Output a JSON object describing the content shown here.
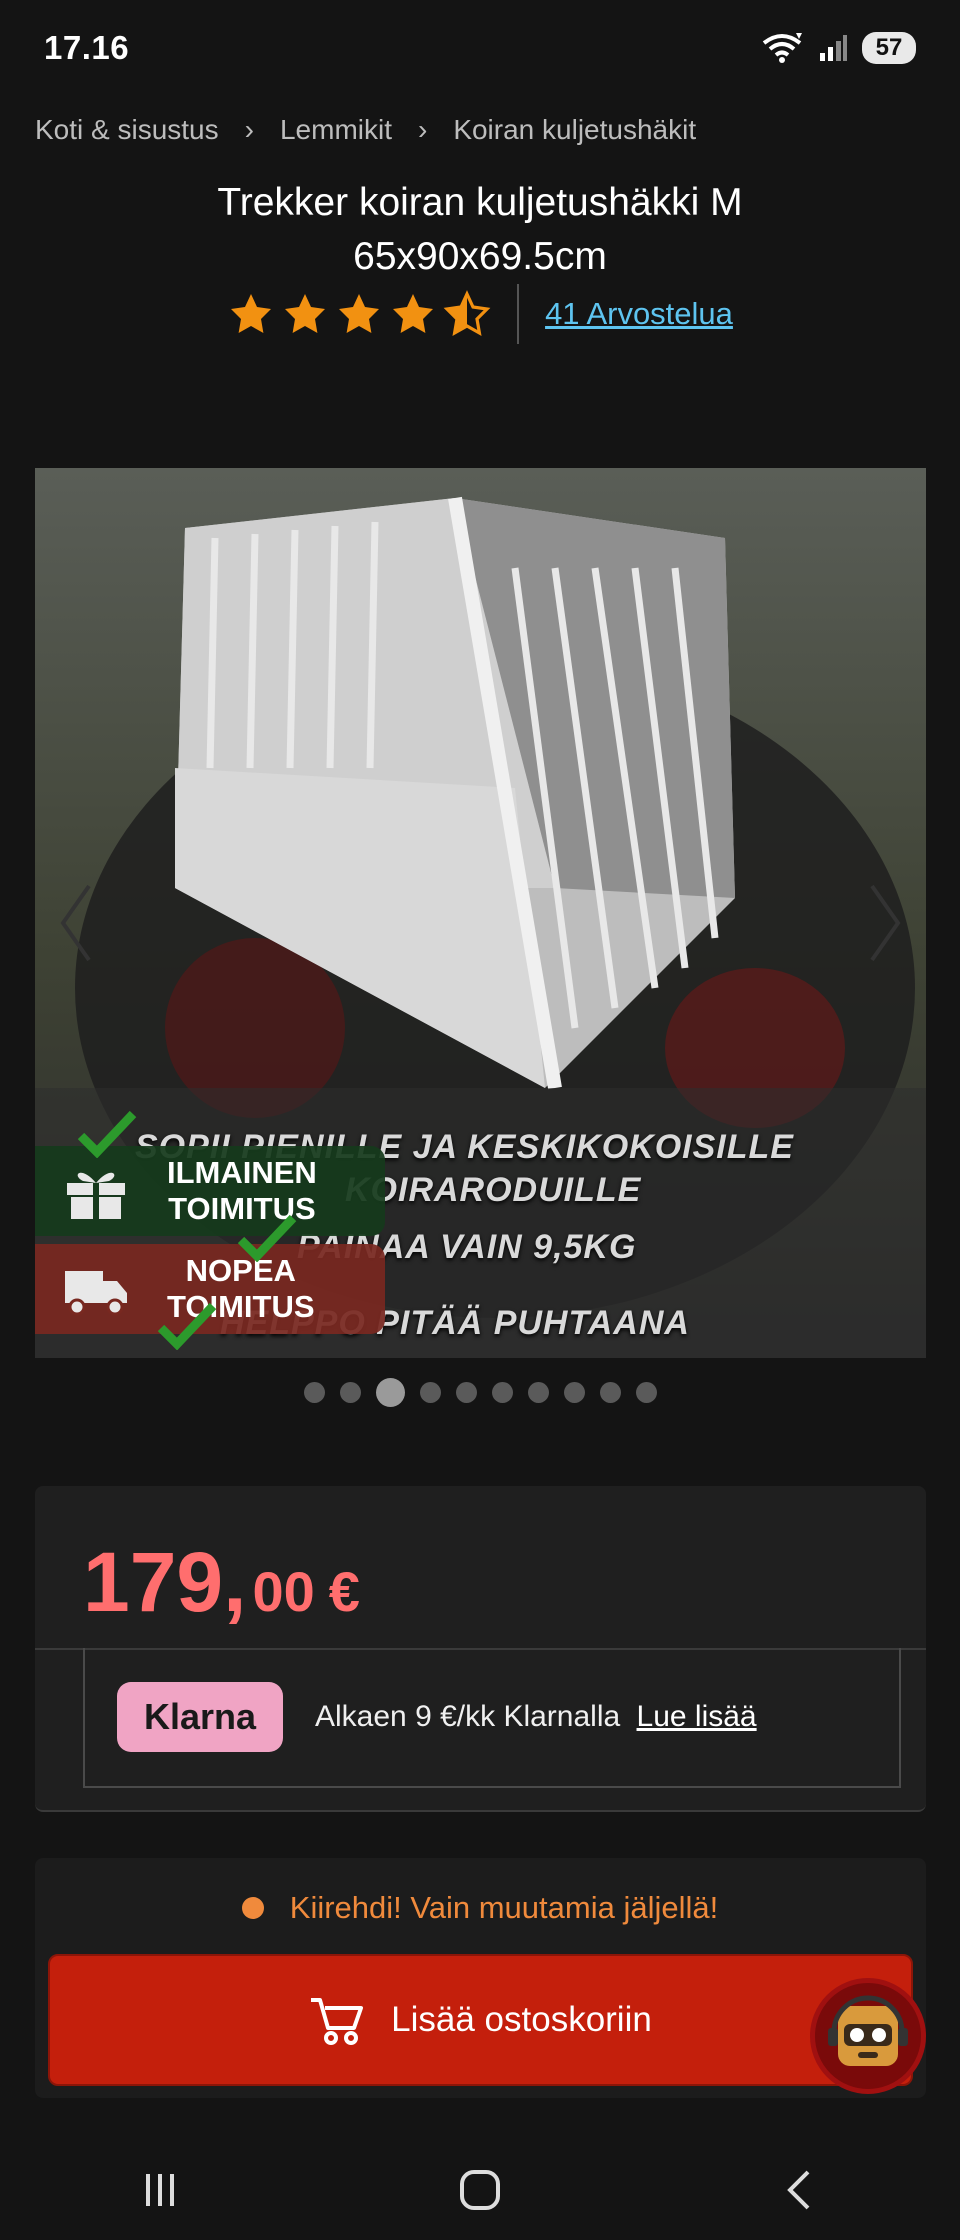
{
  "status_bar": {
    "time": "17.16",
    "battery": "57",
    "icons": [
      "wifi-icon",
      "signal-icon",
      "battery-icon"
    ]
  },
  "breadcrumb": [
    "Koti & sisustus",
    "Lemmikit",
    "Koiran kuljetushäkit"
  ],
  "product": {
    "title_line1": "Trekker koiran kuljetushäkki M",
    "title_line2": "65x90x69.5cm",
    "rating": 4.5,
    "reviews_label": "41 Arvostelua"
  },
  "gallery": {
    "overlay_lines": [
      "SOPII PIENILLE JA KESKIKOKOISILLE",
      "KOIRARODUILLE",
      "PAINAA VAIN 9,5KG",
      "HELPPO PITÄÄ PUHTAANA"
    ],
    "badges": [
      {
        "line1": "ILMAINEN",
        "line2": "TOIMITUS",
        "icon": "gift-icon"
      },
      {
        "line1": "NOPEA",
        "line2": "TOIMITUS",
        "icon": "truck-icon"
      }
    ],
    "dot_count": 10,
    "active_dot": 3
  },
  "price": {
    "integer": "179,",
    "decimals": "00",
    "currency": "€"
  },
  "klarna": {
    "logo": "Klarna",
    "text": "Alkaen 9 €/kk Klarnalla",
    "link": "Lue lisää"
  },
  "stock_message": "Kiirehdi! Vain muutamia jäljellä!",
  "add_to_cart": "Lisää ostoskoriin",
  "colors": {
    "accent_price": "#ff6e6e",
    "button": "#c41f0c",
    "stock": "#f08a3c",
    "link": "#5ec4f0",
    "star": "#f29111",
    "klarna": "#f0a4c4"
  }
}
